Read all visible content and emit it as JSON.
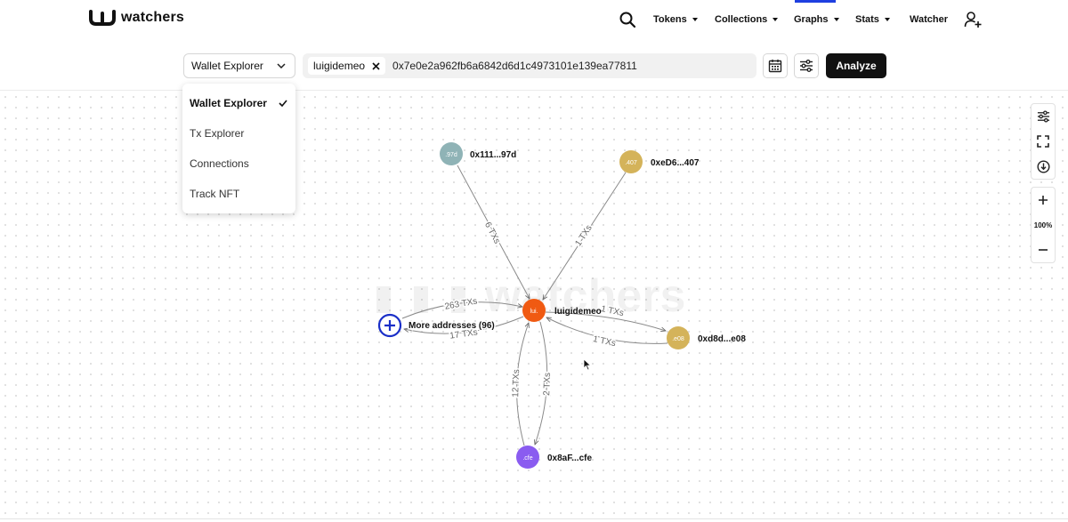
{
  "brand": {
    "name": "watchers"
  },
  "nav": {
    "items": [
      {
        "label": "Tokens",
        "dropdown": true
      },
      {
        "label": "Collections",
        "dropdown": true
      },
      {
        "label": "Graphs",
        "dropdown": true,
        "active": true
      },
      {
        "label": "Stats",
        "dropdown": true
      },
      {
        "label": "Watcher",
        "dropdown": false
      }
    ],
    "search_icon": "search-icon",
    "add_user_icon": "add-user-icon"
  },
  "toolbar": {
    "mode_selected": "Wallet Explorer",
    "chip_label": "luigidemeo",
    "address": "0x7e0e2a962fb6a6842d6d1c4973101e139ea77811",
    "analyze_label": "Analyze"
  },
  "mode_dropdown": {
    "options": [
      "Wallet Explorer",
      "Tx Explorer",
      "Connections",
      "Track NFT"
    ],
    "selected": "Wallet Explorer"
  },
  "graph": {
    "watermark": "watchers",
    "center": {
      "id": "center",
      "badge": "lui.",
      "label": "luigidemeo",
      "color": "#f05a12"
    },
    "nodes": [
      {
        "id": "n97d",
        "badge": ".97d",
        "label": "0x111...97d",
        "color": "#8fb3b6"
      },
      {
        "id": "n407",
        "badge": ".407",
        "label": "0xeD6...407",
        "color": "#d4b35a"
      },
      {
        "id": "ne08",
        "badge": ".e08",
        "label": "0xd8d...e08",
        "color": "#d4b35a"
      },
      {
        "id": "ncfe",
        "badge": ".cfe",
        "label": "0x8aF...cfe",
        "color": "#8a5cf0"
      }
    ],
    "more": {
      "label": "More addresses (96)",
      "color": "#1a2fc8"
    },
    "edges": [
      {
        "from": "n97d",
        "to": "center",
        "label": "6 TXs"
      },
      {
        "from": "n407",
        "to": "center",
        "label": "1 TXs"
      },
      {
        "from": "center",
        "to": "ne08",
        "label": "1 TXs"
      },
      {
        "from": "ne08",
        "to": "center",
        "label": "1 TXs"
      },
      {
        "from": "ncfe",
        "to": "center",
        "label": "12 TXs"
      },
      {
        "from": "center",
        "to": "ncfe",
        "label": "2 TXs"
      },
      {
        "from": "more",
        "to": "center",
        "label": "263 TXs"
      },
      {
        "from": "center",
        "to": "more",
        "label": "17 TXs"
      }
    ]
  },
  "side_tools": {
    "zoom": "100%"
  }
}
